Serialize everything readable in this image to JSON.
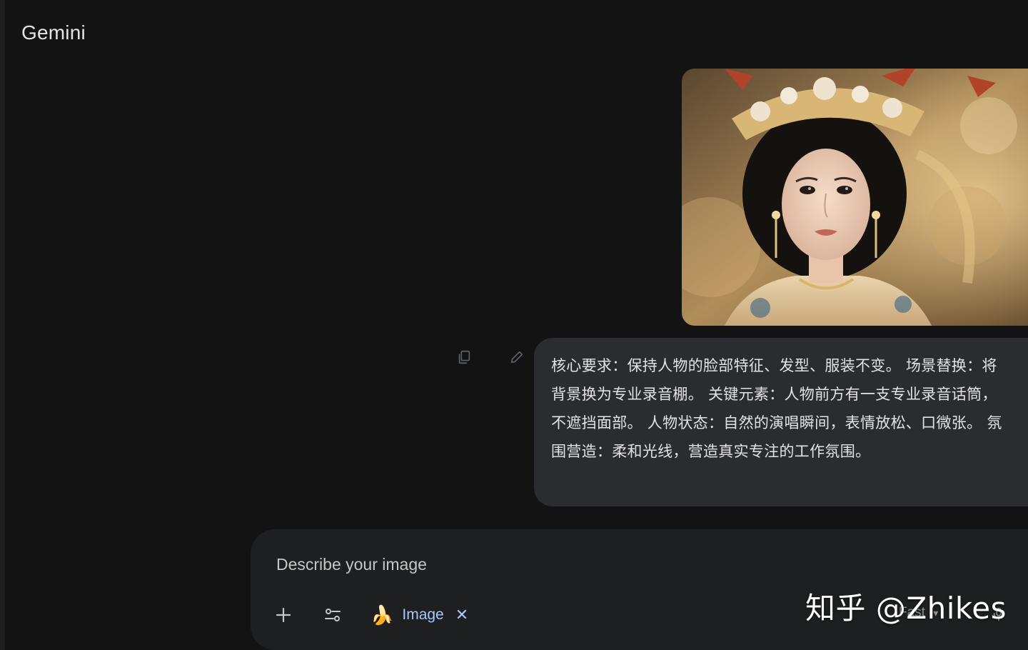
{
  "app": {
    "brand": "Gemini"
  },
  "colors": {
    "background": "#131314",
    "bubble": "#2b2c2f",
    "composer": "#1e1f20",
    "text": "#e3e3e3",
    "accent": "#a8c7fa"
  },
  "conversation": {
    "user_image": {
      "alt": "uploaded reference photo"
    },
    "actions": {
      "copy_icon": "copy-icon",
      "edit_icon": "pencil-icon"
    },
    "user_prompt": "核心要求：保持人物的脸部特征、发型、服装不变。 场景替换：将背景换为专业录音棚。 关键元素：人物前方有一支专业录音话筒，不遮挡面部。 人物状态：自然的演唱瞬间，表情放松、口微张。 氛围营造：柔和光线，营造真实专注的工作氛围。"
  },
  "composer": {
    "placeholder": "Describe your image",
    "value": "",
    "tool_chip": {
      "emoji": "🍌",
      "label": "Image",
      "close": "✕"
    },
    "mode": "Fast"
  },
  "watermark": "知乎 @Zhikes"
}
